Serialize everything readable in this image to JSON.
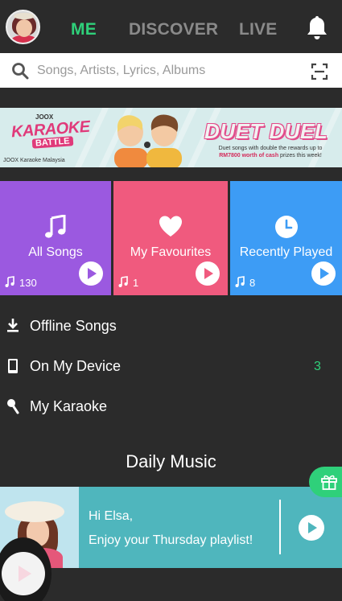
{
  "header": {
    "tabs": [
      {
        "label": "ME",
        "active": true
      },
      {
        "label": "DISCOVER",
        "active": false
      },
      {
        "label": "LIVE",
        "active": false
      }
    ],
    "bell_icon": "bell-icon",
    "accent_color": "#2fd07a"
  },
  "search": {
    "placeholder": "Songs, Artists, Lyrics, Albums",
    "value": "",
    "scan_icon": "scan-icon"
  },
  "banner": {
    "joox": "JOOX",
    "karaoke": "KARAOKE",
    "battle": "BATTLE",
    "footer": "JOOX Karaoke Malaysia",
    "title": "DUET DUEL",
    "line1": "Duet songs with double the rewards up to",
    "line2_highlight": "RM7800 worth of cash",
    "line2_rest": " prizes this week!"
  },
  "tiles": [
    {
      "label": "All Songs",
      "count": "130",
      "color": "#9b59e0",
      "icon": "music-note-icon"
    },
    {
      "label": "My Favourites",
      "count": "1",
      "color": "#f05a7e",
      "icon": "heart-icon"
    },
    {
      "label": "Recently Played",
      "count": "8",
      "color": "#3d9cf5",
      "icon": "clock-icon"
    }
  ],
  "menu": [
    {
      "label": "Offline Songs",
      "icon": "download-icon",
      "count": ""
    },
    {
      "label": "On My Device",
      "icon": "phone-icon",
      "count": "3"
    },
    {
      "label": "My Karaoke",
      "icon": "microphone-icon",
      "count": ""
    }
  ],
  "daily": {
    "title": "Daily Music",
    "greeting": "Hi Elsa,",
    "subtitle": "Enjoy your Thursday playlist!",
    "card_color": "#4fb6bd"
  },
  "gift": {
    "icon": "gift-icon",
    "color": "#2fd07a"
  }
}
